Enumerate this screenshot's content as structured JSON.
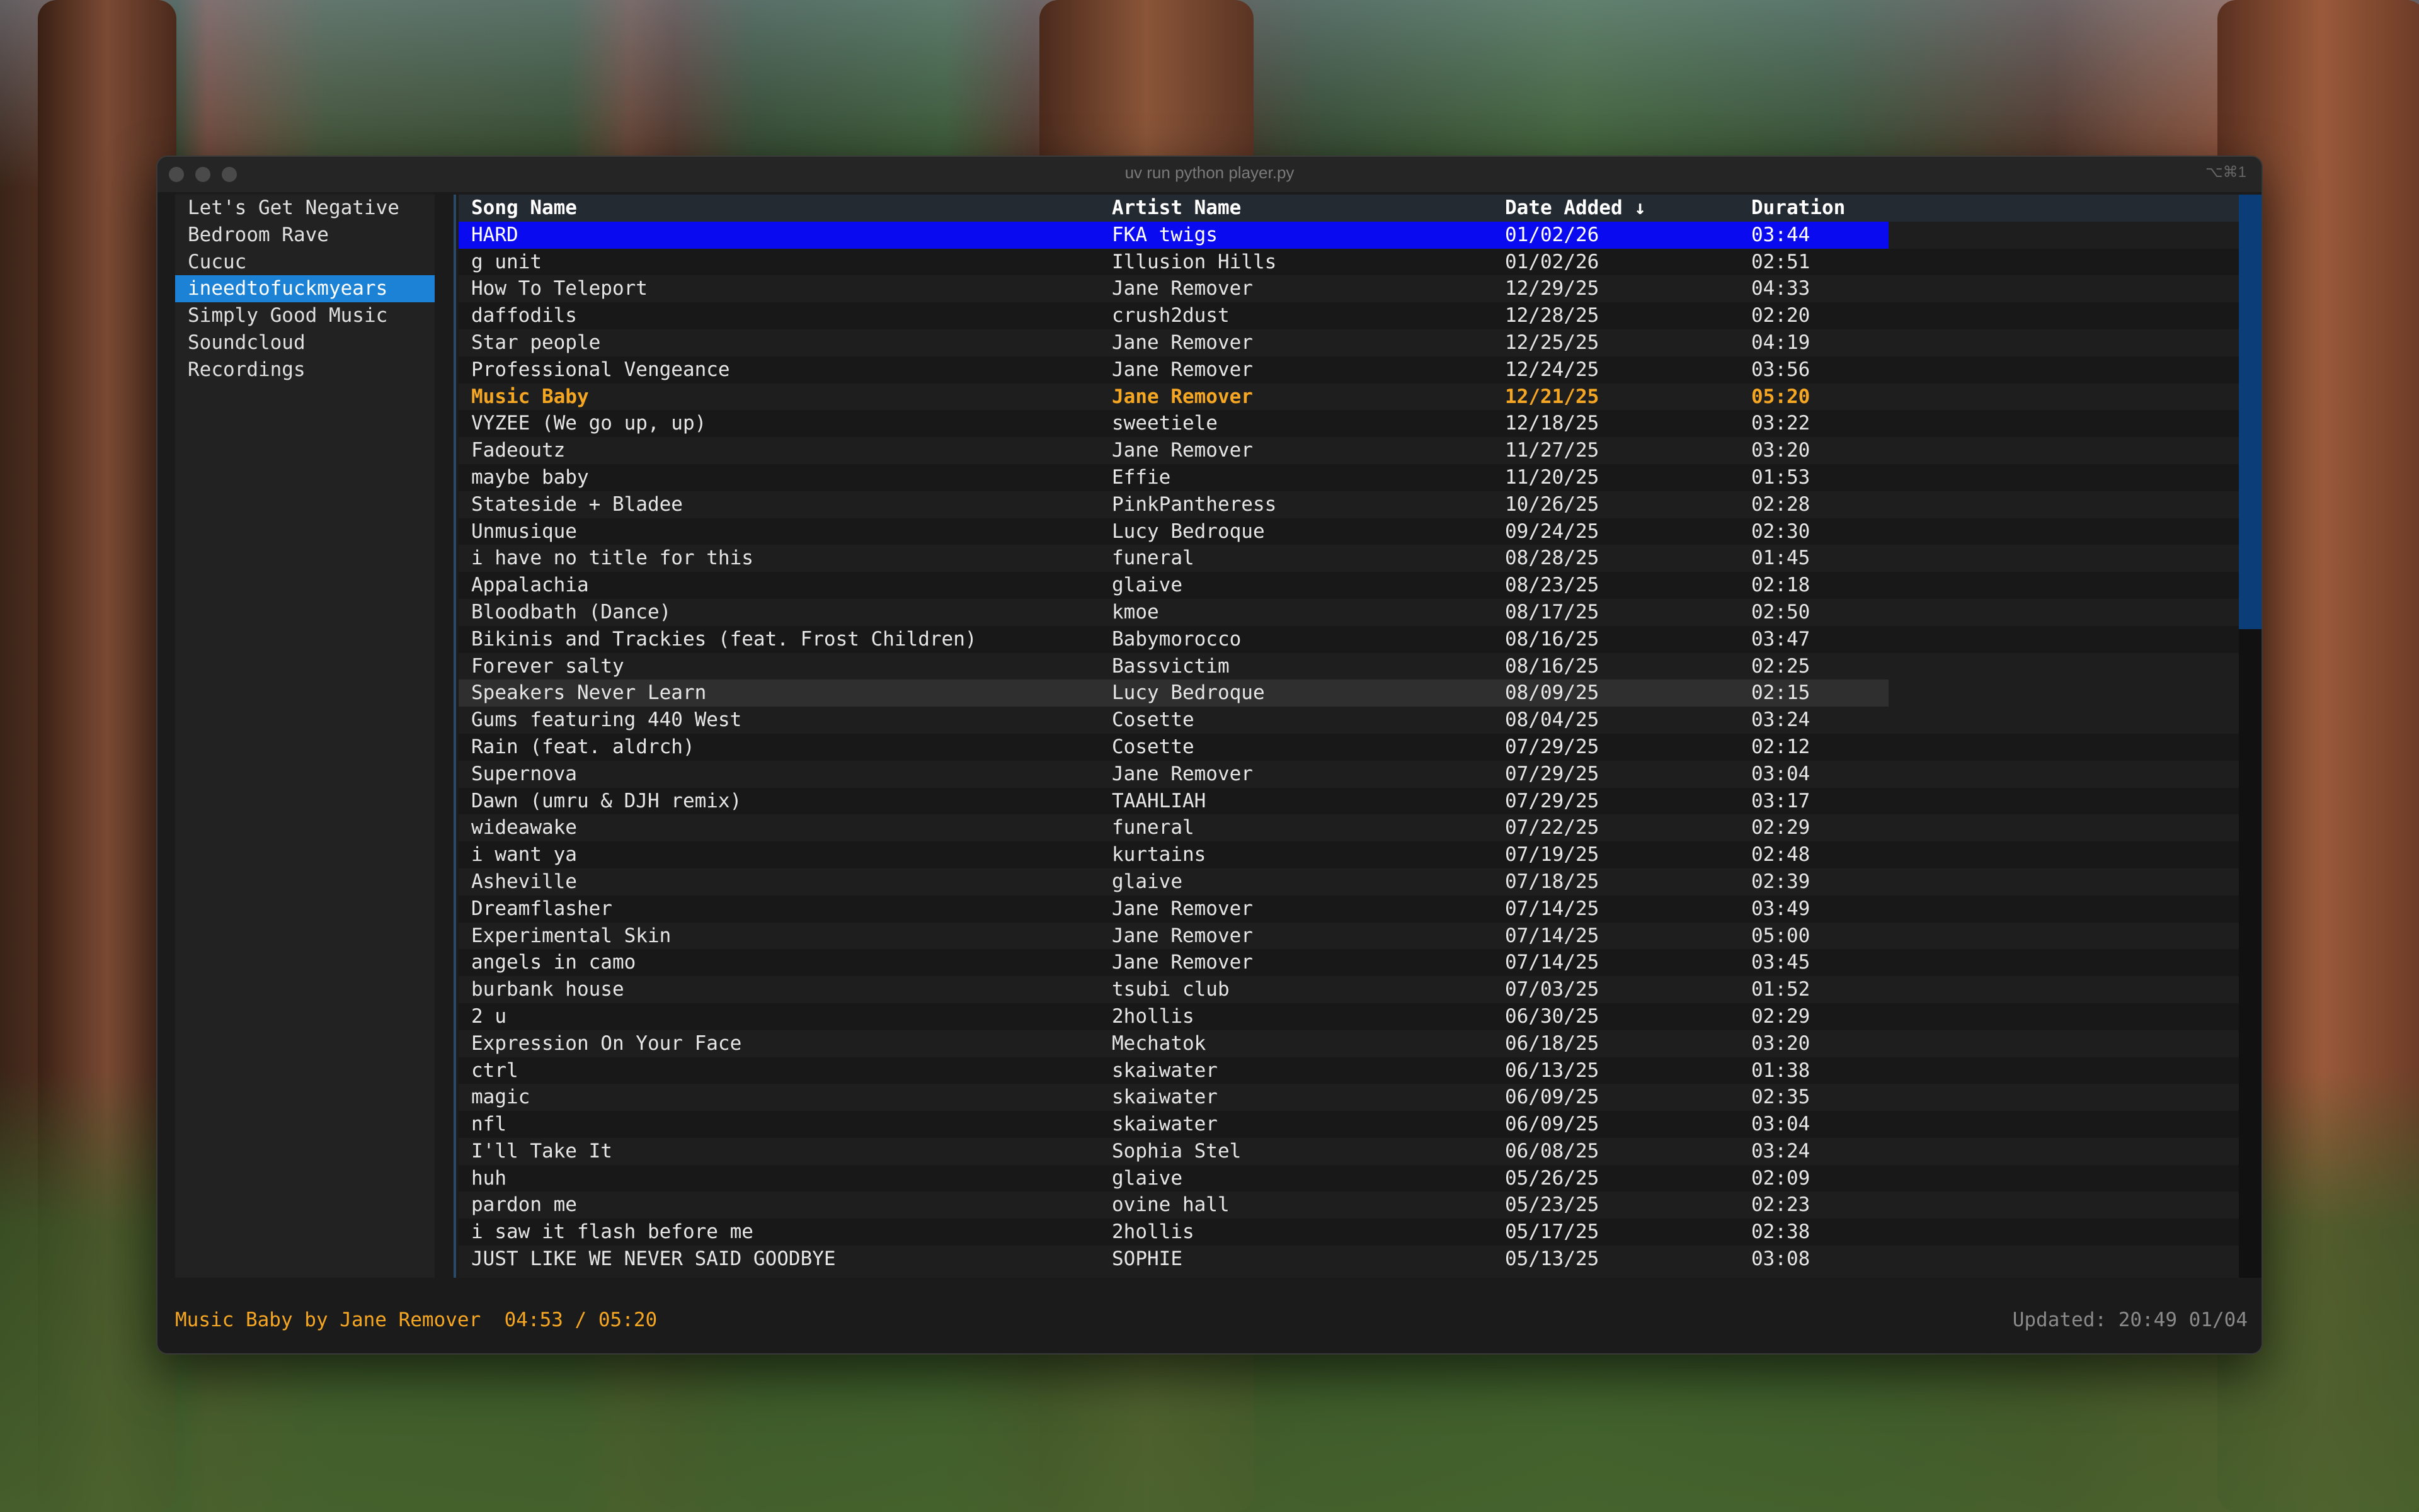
{
  "window": {
    "title": "uv run python player.py",
    "shortcut": "⌥⌘1"
  },
  "sidebar": {
    "items": [
      {
        "label": "Let's Get Negative"
      },
      {
        "label": "Bedroom Rave"
      },
      {
        "label": "Cucuc"
      },
      {
        "label": "ineedtofuckmyears",
        "active": true
      },
      {
        "label": "Simply Good Music"
      },
      {
        "label": "Soundcloud"
      },
      {
        "label": "Recordings"
      }
    ]
  },
  "table": {
    "headers": {
      "song": "Song Name",
      "artist": "Artist Name",
      "date": "Date Added ↓",
      "duration": "Duration"
    },
    "rows": [
      {
        "song": "HARD",
        "artist": "FKA twigs",
        "date": "01/02/26",
        "duration": "03:44",
        "state": "selected"
      },
      {
        "song": "g unit",
        "artist": "Illusion Hills",
        "date": "01/02/26",
        "duration": "02:51"
      },
      {
        "song": "How To Teleport",
        "artist": "Jane Remover",
        "date": "12/29/25",
        "duration": "04:33"
      },
      {
        "song": "daffodils",
        "artist": "crush2dust",
        "date": "12/28/25",
        "duration": "02:20"
      },
      {
        "song": "Star people",
        "artist": "Jane Remover",
        "date": "12/25/25",
        "duration": "04:19"
      },
      {
        "song": "Professional Vengeance",
        "artist": "Jane Remover",
        "date": "12/24/25",
        "duration": "03:56"
      },
      {
        "song": "Music Baby",
        "artist": "Jane Remover",
        "date": "12/21/25",
        "duration": "05:20",
        "state": "playing"
      },
      {
        "song": "VYZEE (We go up, up)",
        "artist": "sweetiele",
        "date": "12/18/25",
        "duration": "03:22"
      },
      {
        "song": "Fadeoutz",
        "artist": "Jane Remover",
        "date": "11/27/25",
        "duration": "03:20"
      },
      {
        "song": "maybe baby",
        "artist": "Effie",
        "date": "11/20/25",
        "duration": "01:53"
      },
      {
        "song": "Stateside + Bladee",
        "artist": "PinkPantheress",
        "date": "10/26/25",
        "duration": "02:28"
      },
      {
        "song": "Unmusique",
        "artist": "Lucy Bedroque",
        "date": "09/24/25",
        "duration": "02:30"
      },
      {
        "song": "i have no title for this",
        "artist": "funeral",
        "date": "08/28/25",
        "duration": "01:45"
      },
      {
        "song": "Appalachia",
        "artist": "glaive",
        "date": "08/23/25",
        "duration": "02:18"
      },
      {
        "song": "Bloodbath (Dance)",
        "artist": "kmoe",
        "date": "08/17/25",
        "duration": "02:50"
      },
      {
        "song": "Bikinis and Trackies (feat. Frost Children)",
        "artist": "Babymorocco",
        "date": "08/16/25",
        "duration": "03:47"
      },
      {
        "song": "Forever salty",
        "artist": "Bassvictim",
        "date": "08/16/25",
        "duration": "02:25"
      },
      {
        "song": "Speakers Never Learn",
        "artist": "Lucy Bedroque",
        "date": "08/09/25",
        "duration": "02:15",
        "state": "hover"
      },
      {
        "song": "Gums featuring 440 West",
        "artist": "Cosette",
        "date": "08/04/25",
        "duration": "03:24"
      },
      {
        "song": "Rain (feat. aldrch)",
        "artist": "Cosette",
        "date": "07/29/25",
        "duration": "02:12"
      },
      {
        "song": "Supernova",
        "artist": "Jane Remover",
        "date": "07/29/25",
        "duration": "03:04"
      },
      {
        "song": "Dawn (umru & DJH remix)",
        "artist": "TAAHLIAH",
        "date": "07/29/25",
        "duration": "03:17"
      },
      {
        "song": "wideawake",
        "artist": "funeral",
        "date": "07/22/25",
        "duration": "02:29"
      },
      {
        "song": "i want ya",
        "artist": "kurtains",
        "date": "07/19/25",
        "duration": "02:48"
      },
      {
        "song": "Asheville",
        "artist": "glaive",
        "date": "07/18/25",
        "duration": "02:39"
      },
      {
        "song": "Dreamflasher",
        "artist": "Jane Remover",
        "date": "07/14/25",
        "duration": "03:49"
      },
      {
        "song": "Experimental Skin",
        "artist": "Jane Remover",
        "date": "07/14/25",
        "duration": "05:00"
      },
      {
        "song": "angels in camo",
        "artist": "Jane Remover",
        "date": "07/14/25",
        "duration": "03:45"
      },
      {
        "song": "burbank house",
        "artist": "tsubi club",
        "date": "07/03/25",
        "duration": "01:52"
      },
      {
        "song": "2 u",
        "artist": "2hollis",
        "date": "06/30/25",
        "duration": "02:29"
      },
      {
        "song": "Expression On Your Face",
        "artist": "Mechatok",
        "date": "06/18/25",
        "duration": "03:20"
      },
      {
        "song": "ctrl",
        "artist": "skaiwater",
        "date": "06/13/25",
        "duration": "01:38"
      },
      {
        "song": "magic",
        "artist": "skaiwater",
        "date": "06/09/25",
        "duration": "02:35"
      },
      {
        "song": "nfl",
        "artist": "skaiwater",
        "date": "06/09/25",
        "duration": "03:04"
      },
      {
        "song": "I'll Take It",
        "artist": "Sophia Stel",
        "date": "06/08/25",
        "duration": "03:24"
      },
      {
        "song": "huh",
        "artist": "glaive",
        "date": "05/26/25",
        "duration": "02:09"
      },
      {
        "song": "pardon me",
        "artist": "ovine hall",
        "date": "05/23/25",
        "duration": "02:23"
      },
      {
        "song": "i saw it flash before me",
        "artist": "2hollis",
        "date": "05/17/25",
        "duration": "02:38"
      },
      {
        "song": "JUST LIKE WE NEVER SAID GOODBYE",
        "artist": "SOPHIE",
        "date": "05/13/25",
        "duration": "03:08"
      }
    ]
  },
  "status": {
    "now_playing": "Music Baby by Jane Remover  04:53 / 05:20",
    "updated": "Updated: 20:49 01/04"
  },
  "colors": {
    "accent_orange": "#f5a623",
    "selection_blue": "#0a0af0",
    "sidebar_active": "#1b82d6"
  }
}
